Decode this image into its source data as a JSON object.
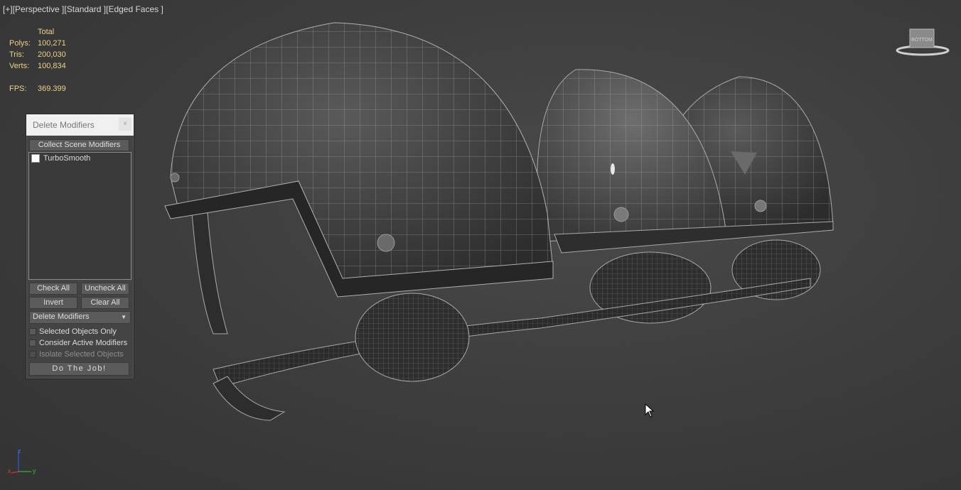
{
  "viewport": {
    "label_parts": [
      "[+]",
      "[Perspective ]",
      "[Standard ]",
      "[Edged Faces ]"
    ]
  },
  "stats": {
    "header": "Total",
    "polys_label": "Polys:",
    "polys": "100,271",
    "tris_label": "Tris:",
    "tris": "200,030",
    "verts_label": "Verts:",
    "verts": "100,834",
    "fps_label": "FPS:",
    "fps": "369.399"
  },
  "dialog": {
    "title": "Delete Modifiers",
    "close": "×",
    "collect_button": "Collect Scene Modifiers",
    "list_items": [
      {
        "label": "TurboSmooth",
        "checked": false
      }
    ],
    "check_all": "Check All",
    "uncheck_all": "Uncheck All",
    "invert": "Invert",
    "clear_all": "Clear All",
    "mode_select": "Delete Modifiers",
    "selected_only": "Selected Objects Only",
    "consider_active": "Consider Active Modifiers",
    "isolate_selected": "Isolate Selected Objects",
    "do_job": "Do The Job!"
  },
  "axis": {
    "x": "x",
    "y": "y",
    "z": "z"
  },
  "viewcube": {
    "face_text": "BOTTOM"
  },
  "colors": {
    "stats_text": "#e8d28a",
    "axis_x": "#c03030",
    "axis_y": "#30a030",
    "axis_z": "#3050c8"
  }
}
